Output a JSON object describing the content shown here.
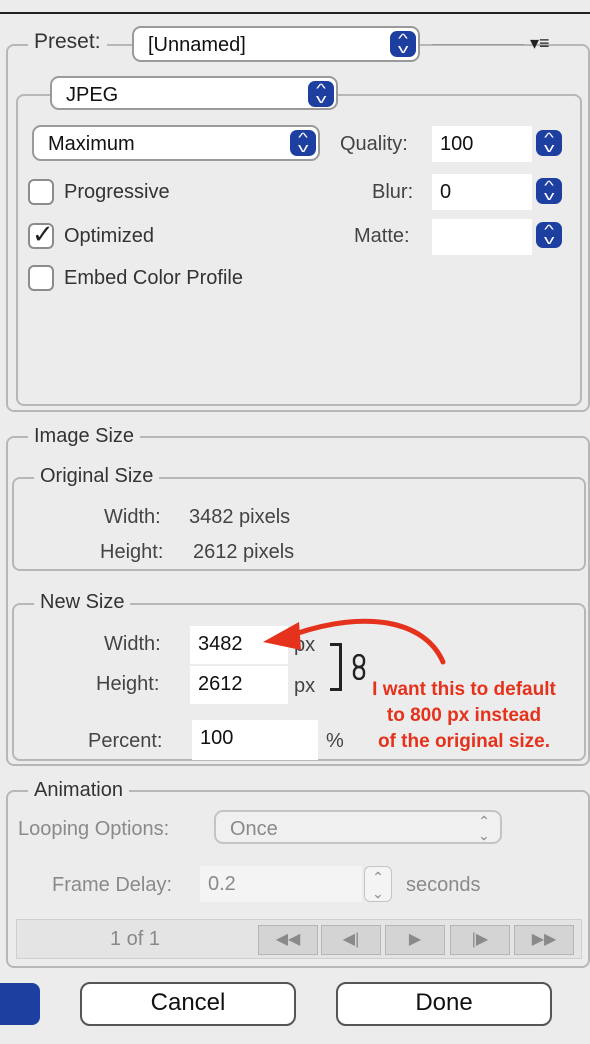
{
  "preset": {
    "label": "Preset:",
    "value": "[Unnamed]",
    "menu_icon": "▾≡"
  },
  "format": {
    "value": "JPEG",
    "quality_preset": "Maximum",
    "quality_label": "Quality:",
    "quality_value": "100",
    "blur_label": "Blur:",
    "blur_value": "0",
    "matte_label": "Matte:",
    "matte_value": "",
    "progressive_label": "Progressive",
    "progressive_checked": false,
    "optimized_label": "Optimized",
    "optimized_checked": true,
    "embed_label": "Embed Color Profile",
    "embed_checked": false
  },
  "image_size": {
    "title": "Image Size",
    "original": {
      "title": "Original Size",
      "width_label": "Width:",
      "width_value": "3482 pixels",
      "height_label": "Height:",
      "height_value": "2612 pixels"
    },
    "new": {
      "title": "New Size",
      "width_label": "Width:",
      "width_value": "3482",
      "height_label": "Height:",
      "height_value": "2612",
      "unit": "px",
      "percent_label": "Percent:",
      "percent_value": "100",
      "percent_unit": "%"
    }
  },
  "annotation": {
    "line1": "I want this to default",
    "line2": "to 800 px instead",
    "line3": "of the original size.",
    "color": "#e5321c"
  },
  "animation": {
    "title": "Animation",
    "looping_label": "Looping Options:",
    "looping_value": "Once",
    "delay_label": "Frame Delay:",
    "delay_value": "0.2",
    "delay_unit": "seconds",
    "frame_counter": "1 of 1",
    "nav": {
      "first": "◀◀",
      "prev": "◀|",
      "play": "▶",
      "next": "|▶",
      "last": "▶▶"
    }
  },
  "buttons": {
    "cancel": "Cancel",
    "done": "Done"
  }
}
